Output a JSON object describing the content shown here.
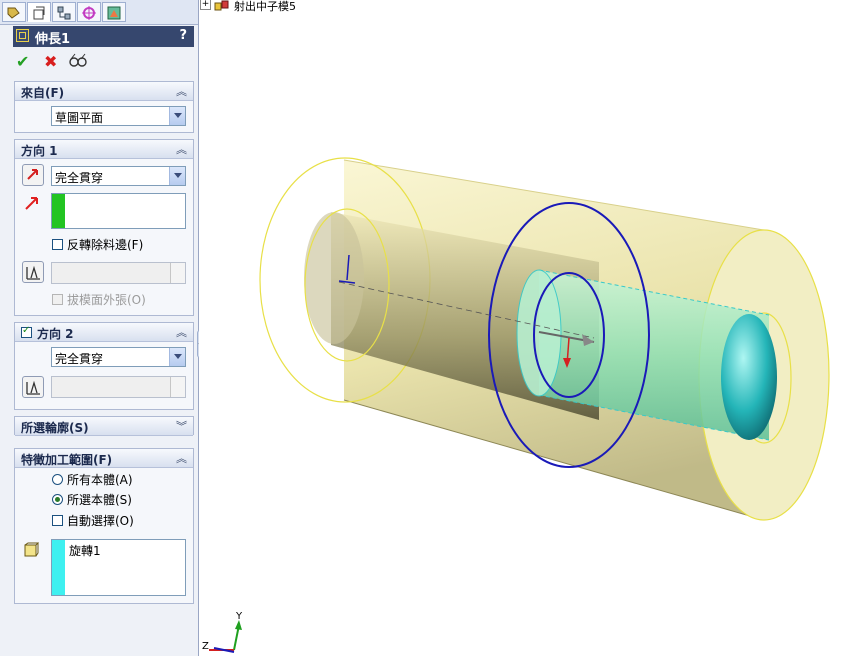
{
  "feature": {
    "title": "伸長1",
    "help": "?"
  },
  "tree": {
    "expander": "+",
    "item": "射出中子模5"
  },
  "from_section": {
    "label": "來自(F)",
    "value": "草圖平面"
  },
  "direction1": {
    "label": "方向 1",
    "end_condition": "完全貫穿",
    "flip_side": "反轉除料邊(F)",
    "draft_outward": "拔模面外張(O)"
  },
  "direction2": {
    "label": "方向 2",
    "end_condition": "完全貫穿",
    "enabled": true
  },
  "selected_contours": {
    "label": "所選輪廓(S)"
  },
  "feature_scope": {
    "label": "特徵加工範圍(F)",
    "option_all": "所有本體(A)",
    "option_selected": "所選本體(S)",
    "auto_select": "自動選擇(O)",
    "bodies": [
      "旋轉1"
    ]
  },
  "axes": {
    "y": "Y",
    "z": "Z"
  },
  "colors": {
    "accent": "#36476e",
    "body": "#f5f0c0",
    "cut": "#2fd6cc",
    "sketch": "#1a1ab8"
  }
}
